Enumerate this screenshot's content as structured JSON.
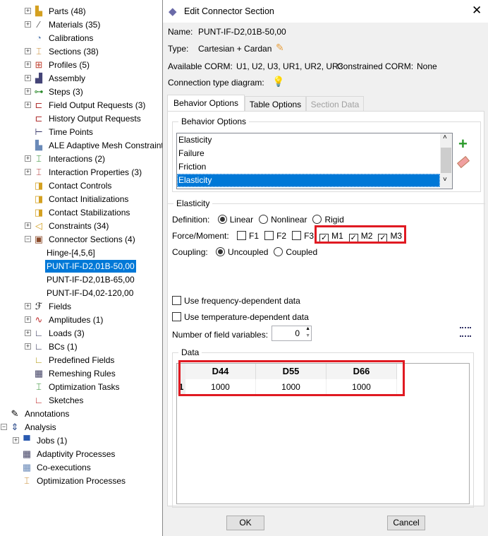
{
  "tree": {
    "items": [
      {
        "label": "Parts (48)",
        "icon": "parts-icon",
        "expander": "+"
      },
      {
        "label": "Materials (35)",
        "icon": "materials-icon",
        "expander": "+"
      },
      {
        "label": "Calibrations",
        "icon": "calibrations-icon",
        "expander": ""
      },
      {
        "label": "Sections (38)",
        "icon": "sections-icon",
        "expander": "+"
      },
      {
        "label": "Profiles (5)",
        "icon": "profiles-icon",
        "expander": "+"
      },
      {
        "label": "Assembly",
        "icon": "assembly-icon",
        "expander": "+"
      },
      {
        "label": "Steps (3)",
        "icon": "steps-icon",
        "expander": "+"
      },
      {
        "label": "Field Output Requests (3)",
        "icon": "field-output-icon",
        "expander": "+"
      },
      {
        "label": "History Output Requests",
        "icon": "history-output-icon",
        "expander": ""
      },
      {
        "label": "Time Points",
        "icon": "time-points-icon",
        "expander": ""
      },
      {
        "label": "ALE Adaptive Mesh Constraints",
        "icon": "ale-mesh-icon",
        "expander": ""
      },
      {
        "label": "Interactions (2)",
        "icon": "interactions-icon",
        "expander": "+"
      },
      {
        "label": "Interaction Properties (3)",
        "icon": "interaction-properties-icon",
        "expander": "+"
      },
      {
        "label": "Contact Controls",
        "icon": "contact-controls-icon",
        "expander": ""
      },
      {
        "label": "Contact Initializations",
        "icon": "contact-init-icon",
        "expander": ""
      },
      {
        "label": "Contact Stabilizations",
        "icon": "contact-stab-icon",
        "expander": ""
      },
      {
        "label": "Constraints (34)",
        "icon": "constraints-icon",
        "expander": "+"
      },
      {
        "label": "Connector Sections (4)",
        "icon": "connector-sections-icon",
        "expander": "−"
      }
    ],
    "connector_children": [
      "Hinge-[4,5,6]",
      "PUNT-IF-D2,01B-50,00",
      "PUNT-IF-D2,01B-65,00",
      "PUNT-IF-D4,02-120,00"
    ],
    "selected_child": 1,
    "items2": [
      {
        "label": "Fields",
        "icon": "fields-icon",
        "expander": "+"
      },
      {
        "label": "Amplitudes (1)",
        "icon": "amplitudes-icon",
        "expander": "+"
      },
      {
        "label": "Loads (3)",
        "icon": "loads-icon",
        "expander": "+"
      },
      {
        "label": "BCs (1)",
        "icon": "bcs-icon",
        "expander": "+"
      },
      {
        "label": "Predefined Fields",
        "icon": "predefined-fields-icon",
        "expander": ""
      },
      {
        "label": "Remeshing Rules",
        "icon": "remeshing-icon",
        "expander": ""
      },
      {
        "label": "Optimization Tasks",
        "icon": "optimization-tasks-icon",
        "expander": ""
      },
      {
        "label": "Sketches",
        "icon": "sketches-icon",
        "expander": ""
      }
    ],
    "annotations": "Annotations",
    "analysis": "Analysis",
    "analysis_children": [
      {
        "label": "Jobs (1)",
        "icon": "jobs-icon",
        "expander": "+"
      },
      {
        "label": "Adaptivity Processes",
        "icon": "adaptivity-icon",
        "expander": ""
      },
      {
        "label": "Co-executions",
        "icon": "co-executions-icon",
        "expander": ""
      },
      {
        "label": "Optimization Processes",
        "icon": "optimization-processes-icon",
        "expander": ""
      }
    ]
  },
  "dialog": {
    "title": "Edit Connector Section",
    "name_label": "Name:",
    "name_value": "PUNT-IF-D2,01B-50,00",
    "type_label": "Type:",
    "type_value": "Cartesian + Cardan",
    "available_label": "Available CORM:",
    "available_value": "U1, U2, U3, UR1, UR2, UR3",
    "constrained_label": "Constrained CORM:",
    "constrained_value": "None",
    "diagram_label": "Connection type diagram:",
    "tabs": [
      "Behavior Options",
      "Table Options",
      "Section Data"
    ],
    "behavior_group": "Behavior Options",
    "behaviors": [
      "Elasticity",
      "Failure",
      "Friction",
      "Elasticity"
    ],
    "selected_behavior": 3,
    "elasticity_group": "Elasticity",
    "definition_label": "Definition:",
    "definition_options": [
      "Linear",
      "Nonlinear",
      "Rigid"
    ],
    "definition_selected": "Linear",
    "force_label": "Force/Moment:",
    "force_options": [
      {
        "label": "F1",
        "checked": false
      },
      {
        "label": "F2",
        "checked": false
      },
      {
        "label": "F3",
        "checked": false
      },
      {
        "label": "M1",
        "checked": true
      },
      {
        "label": "M2",
        "checked": true
      },
      {
        "label": "M3",
        "checked": true
      }
    ],
    "coupling_label": "Coupling:",
    "coupling_options": [
      "Uncoupled",
      "Coupled"
    ],
    "coupling_selected": "Uncoupled",
    "freq_label": "Use frequency-dependent data",
    "freq_checked": false,
    "temp_label": "Use temperature-dependent data",
    "temp_checked": false,
    "fieldvars_label": "Number of field variables:",
    "fieldvars_value": "0",
    "data_group": "Data",
    "table": {
      "columns": [
        "D44",
        "D55",
        "D66"
      ],
      "rows": [
        {
          "index": "1",
          "values": [
            "1000",
            "1000",
            "1000"
          ]
        }
      ]
    },
    "ok": "OK",
    "cancel": "Cancel",
    "highlight_color": "#e01a22",
    "selection_color": "#0078d7"
  }
}
